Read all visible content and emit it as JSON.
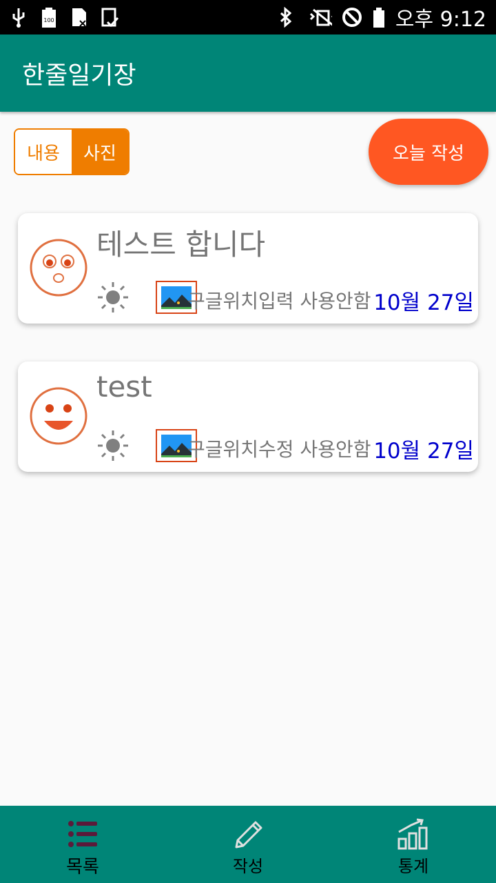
{
  "status_bar": {
    "time": "오후 9:12",
    "icons": [
      "usb-icon",
      "battery-100-icon",
      "sim-off-icon",
      "tablet-check-icon",
      "bluetooth-icon",
      "vibrate-off-icon",
      "do-not-disturb-icon",
      "battery-icon"
    ]
  },
  "app_bar": {
    "title": "한줄일기장"
  },
  "toggle": {
    "left_label": "내용",
    "right_label": "사진",
    "selected": "사진"
  },
  "write_button": {
    "label": "오늘 작성"
  },
  "entries": [
    {
      "title": "테스트 합니다",
      "mood_icon": "surprised-face-icon",
      "weather_icon": "sun-icon",
      "photo_icon": "image-icon",
      "location": "구글위치입력 사용안함",
      "date": "10월 27일"
    },
    {
      "title": "test",
      "mood_icon": "happy-face-icon",
      "weather_icon": "sun-icon",
      "photo_icon": "image-icon",
      "location": "구글위치수정 사용안함",
      "date": "10월 27일"
    }
  ],
  "bottom_nav": {
    "items": [
      {
        "label": "목록",
        "icon": "list-icon",
        "active": true
      },
      {
        "label": "작성",
        "icon": "pencil-icon",
        "active": false
      },
      {
        "label": "통계",
        "icon": "chart-icon",
        "active": false
      }
    ]
  },
  "colors": {
    "primary": "#008577",
    "accent": "#ef7d00",
    "fab": "#ff5722",
    "date": "#0000cc"
  }
}
